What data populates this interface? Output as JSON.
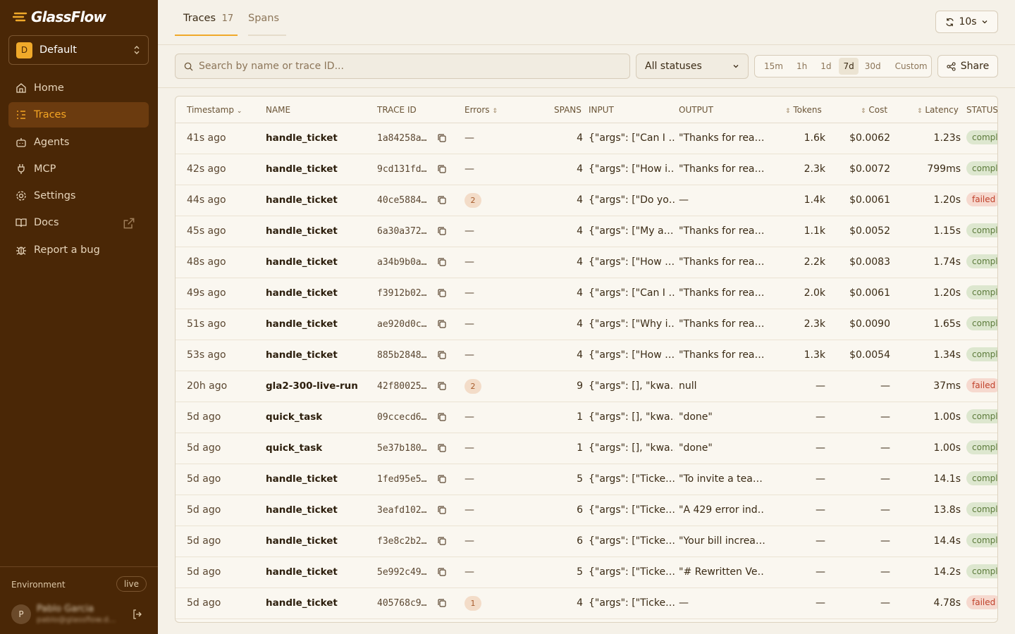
{
  "sidebar": {
    "logo": "GlassFlow",
    "workspace": {
      "initial": "D",
      "name": "Default"
    },
    "nav": [
      {
        "label": "Home",
        "icon": "home-icon"
      },
      {
        "label": "Traces",
        "icon": "traces-icon",
        "active": true
      },
      {
        "label": "Agents",
        "icon": "bot-icon"
      },
      {
        "label": "MCP",
        "icon": "plug-icon"
      },
      {
        "label": "Settings",
        "icon": "gear-icon"
      },
      {
        "label": "Docs",
        "icon": "book-icon",
        "external": true
      },
      {
        "label": "Report a bug",
        "icon": "bug-icon"
      }
    ],
    "environment": {
      "label": "Environment",
      "value": "live"
    },
    "user": {
      "initial": "P",
      "name": "Pablo Garcia",
      "email": "pablo@glassflow.d..."
    }
  },
  "tabs": [
    {
      "label": "Traces",
      "count": "17",
      "active": true
    },
    {
      "label": "Spans",
      "count": ""
    }
  ],
  "refresh": {
    "label": "10s"
  },
  "filters": {
    "search_placeholder": "Search by name or trace ID...",
    "status": "All statuses",
    "ranges": [
      "15m",
      "1h",
      "1d",
      "7d",
      "30d",
      "Custom"
    ],
    "active_range": "7d",
    "share_label": "Share"
  },
  "table": {
    "columns": {
      "timestamp": "Timestamp",
      "name": "NAME",
      "trace_id": "TRACE ID",
      "errors": "Errors",
      "spans": "SPANS",
      "input": "INPUT",
      "output": "OUTPUT",
      "tokens": "Tokens",
      "cost": "Cost",
      "latency": "Latency",
      "status": "STATUS"
    },
    "rows": [
      {
        "time": "41s ago",
        "name": "handle_ticket",
        "trace_id": "1a84258a…",
        "errors": "—",
        "spans": "4",
        "input": "{\"args\": [\"Can I …",
        "output": "\"Thanks for rea…",
        "tokens": "1.6k",
        "cost": "$0.0062",
        "latency": "1.23s",
        "status": "completed"
      },
      {
        "time": "42s ago",
        "name": "handle_ticket",
        "trace_id": "9cd131fd…",
        "errors": "—",
        "spans": "4",
        "input": "{\"args\": [\"How i…",
        "output": "\"Thanks for rea…",
        "tokens": "2.3k",
        "cost": "$0.0072",
        "latency": "799ms",
        "status": "completed"
      },
      {
        "time": "44s ago",
        "name": "handle_ticket",
        "trace_id": "40ce5884…",
        "errors": "2",
        "spans": "4",
        "input": "{\"args\": [\"Do yo…",
        "output": "—",
        "tokens": "1.4k",
        "cost": "$0.0061",
        "latency": "1.20s",
        "status": "failed"
      },
      {
        "time": "45s ago",
        "name": "handle_ticket",
        "trace_id": "6a30a372…",
        "errors": "—",
        "spans": "4",
        "input": "{\"args\": [\"My a…",
        "output": "\"Thanks for rea…",
        "tokens": "1.1k",
        "cost": "$0.0052",
        "latency": "1.15s",
        "status": "completed"
      },
      {
        "time": "48s ago",
        "name": "handle_ticket",
        "trace_id": "a34b9b0a…",
        "errors": "—",
        "spans": "4",
        "input": "{\"args\": [\"How …",
        "output": "\"Thanks for rea…",
        "tokens": "2.2k",
        "cost": "$0.0083",
        "latency": "1.74s",
        "status": "completed"
      },
      {
        "time": "49s ago",
        "name": "handle_ticket",
        "trace_id": "f3912b02…",
        "errors": "—",
        "spans": "4",
        "input": "{\"args\": [\"Can I …",
        "output": "\"Thanks for rea…",
        "tokens": "2.0k",
        "cost": "$0.0061",
        "latency": "1.20s",
        "status": "completed"
      },
      {
        "time": "51s ago",
        "name": "handle_ticket",
        "trace_id": "ae920d0c…",
        "errors": "—",
        "spans": "4",
        "input": "{\"args\": [\"Why i…",
        "output": "\"Thanks for rea…",
        "tokens": "2.3k",
        "cost": "$0.0090",
        "latency": "1.65s",
        "status": "completed"
      },
      {
        "time": "53s ago",
        "name": "handle_ticket",
        "trace_id": "885b2848…",
        "errors": "—",
        "spans": "4",
        "input": "{\"args\": [\"How …",
        "output": "\"Thanks for rea…",
        "tokens": "1.3k",
        "cost": "$0.0054",
        "latency": "1.34s",
        "status": "completed"
      },
      {
        "time": "20h ago",
        "name": "gla2-300-live-run",
        "trace_id": "42f80025…",
        "errors": "2",
        "spans": "9",
        "input": "{\"args\": [], \"kwa…",
        "output": "null",
        "tokens": "—",
        "cost": "—",
        "latency": "37ms",
        "status": "failed"
      },
      {
        "time": "5d ago",
        "name": "quick_task",
        "trace_id": "09ccecd6…",
        "errors": "—",
        "spans": "1",
        "input": "{\"args\": [], \"kwa…",
        "output": "\"done\"",
        "tokens": "—",
        "cost": "—",
        "latency": "1.00s",
        "status": "completed"
      },
      {
        "time": "5d ago",
        "name": "quick_task",
        "trace_id": "5e37b180…",
        "errors": "—",
        "spans": "1",
        "input": "{\"args\": [], \"kwa…",
        "output": "\"done\"",
        "tokens": "—",
        "cost": "—",
        "latency": "1.00s",
        "status": "completed"
      },
      {
        "time": "5d ago",
        "name": "handle_ticket",
        "trace_id": "1fed95e5…",
        "errors": "—",
        "spans": "5",
        "input": "{\"args\": [\"Ticke…",
        "output": "\"To invite a tea…",
        "tokens": "—",
        "cost": "—",
        "latency": "14.1s",
        "status": "completed"
      },
      {
        "time": "5d ago",
        "name": "handle_ticket",
        "trace_id": "3eafd102…",
        "errors": "—",
        "spans": "6",
        "input": "{\"args\": [\"Ticke…",
        "output": "\"A 429 error ind…",
        "tokens": "—",
        "cost": "—",
        "latency": "13.8s",
        "status": "completed"
      },
      {
        "time": "5d ago",
        "name": "handle_ticket",
        "trace_id": "f3e8c2b2…",
        "errors": "—",
        "spans": "6",
        "input": "{\"args\": [\"Ticke…",
        "output": "\"Your bill increa…",
        "tokens": "—",
        "cost": "—",
        "latency": "14.4s",
        "status": "completed"
      },
      {
        "time": "5d ago",
        "name": "handle_ticket",
        "trace_id": "5e992c49…",
        "errors": "—",
        "spans": "5",
        "input": "{\"args\": [\"Ticke…",
        "output": "\"# Rewritten Ve…",
        "tokens": "—",
        "cost": "—",
        "latency": "14.2s",
        "status": "completed"
      },
      {
        "time": "5d ago",
        "name": "handle_ticket",
        "trace_id": "405768c9…",
        "errors": "1",
        "spans": "4",
        "input": "{\"args\": [\"Ticke…",
        "output": "—",
        "tokens": "—",
        "cost": "—",
        "latency": "4.78s",
        "status": "failed"
      }
    ]
  },
  "colors": {
    "sidebar_bg": "#4a2706",
    "accent": "#f0a92a",
    "page_bg": "#f5f1e8",
    "fail": "#c0412a",
    "ok": "#5c7a3a"
  }
}
